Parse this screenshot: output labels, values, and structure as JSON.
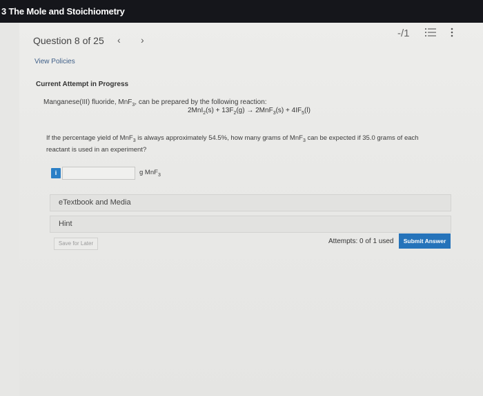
{
  "header": {
    "title": "3 The Mole and Stoichiometry"
  },
  "nav": {
    "question_label": "Question 8 of 25",
    "prev_glyph": "‹",
    "next_glyph": "›",
    "score": "-/1",
    "list_icon": "list-icon",
    "menu_icon": "kebab-menu-icon"
  },
  "links": {
    "view_policies": "View Policies"
  },
  "attempt": {
    "title": "Current Attempt in Progress"
  },
  "problem": {
    "intro_prefix": "Manganese(III) fluoride, MnF",
    "intro_sub": "3",
    "intro_suffix": ", can be prepared by the following reaction:",
    "eq": {
      "p1": "2MnI",
      "s1": "2",
      "p2": "(s) + 13F",
      "s2": "2",
      "p3": "(g) → 2MnF",
      "s3": "3",
      "p4": "(s) + 4IF",
      "s4": "5",
      "p5": "(l)"
    },
    "question": {
      "q1": "If the percentage yield of MnF",
      "qs1": "3",
      "q2": " is always approximately 54.5%, how many grams of MnF",
      "qs2": "3",
      "q3": " can be expected if 35.0 grams of each reactant is used in an experiment?"
    }
  },
  "answer": {
    "info_label": "i",
    "value": "",
    "placeholder": "",
    "unit_prefix": "g MnF",
    "unit_sub": "3"
  },
  "panels": {
    "etextbook": "eTextbook and Media",
    "hint": "Hint"
  },
  "footer": {
    "save_label": "Save for Later",
    "attempts": "Attempts: 0 of 1 used",
    "submit_label": "Submit Answer"
  },
  "colors": {
    "accent": "#2573ba",
    "topbar": "#15161b",
    "info": "#2a7fc6"
  }
}
